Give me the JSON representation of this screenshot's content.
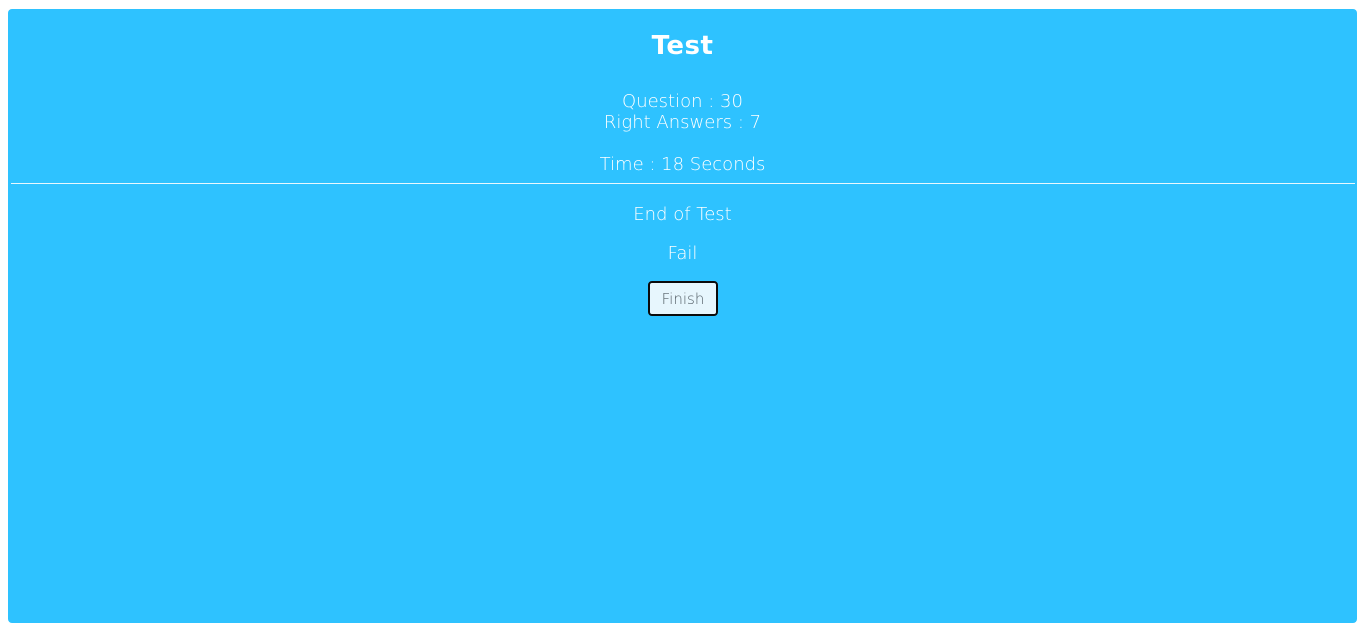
{
  "header": {
    "title": "Test"
  },
  "stats": {
    "questions_label": "Question : 30",
    "right_answers_label": "Right Answers : 7",
    "time_label": "Time : 18 Seconds"
  },
  "result": {
    "end_text": "End of Test",
    "status": "Fail",
    "finish_button_label": "Finish"
  },
  "colors": {
    "panel_background": "#2ec2ff",
    "text": "#ffffff",
    "button_background": "#e7f6fd",
    "button_border": "#0b0b0b"
  }
}
